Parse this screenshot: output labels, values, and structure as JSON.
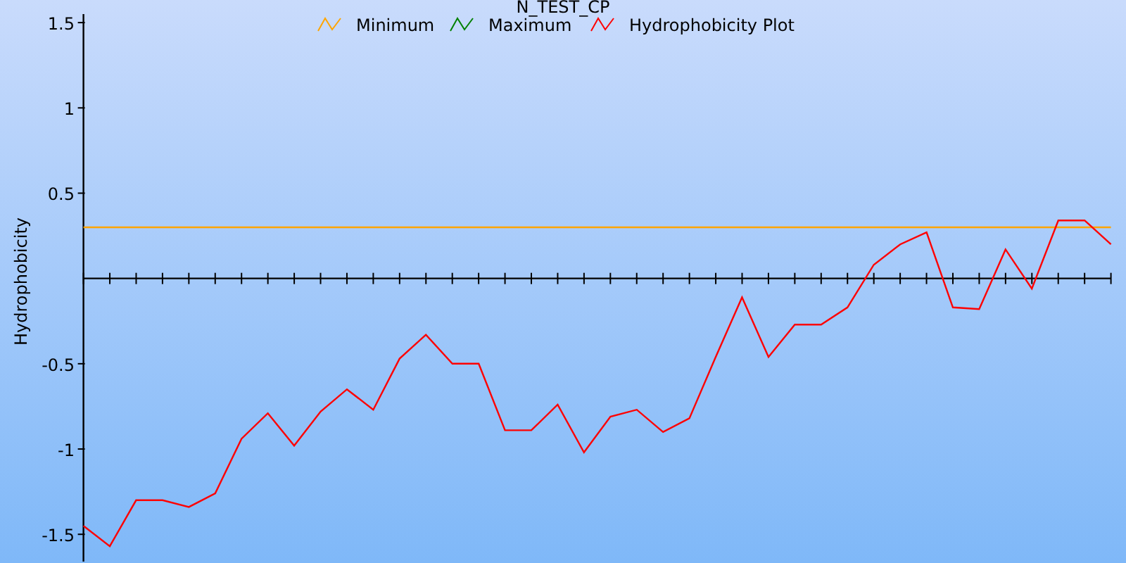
{
  "chart_data": {
    "type": "line",
    "title": "N_TEST_CP",
    "ylabel": "Hydrophobicity",
    "legend": "top",
    "ylim": [
      -1.66,
      1.55
    ],
    "yticks": [
      -1.5,
      -1,
      -0.5,
      0.5,
      1,
      1.5
    ],
    "series": [
      {
        "name": "Minimum",
        "color": "#ffa500",
        "values": [
          0.3,
          0.3,
          0.3,
          0.3,
          0.3,
          0.3,
          0.3,
          0.3,
          0.3,
          0.3,
          0.3,
          0.3,
          0.3,
          0.3,
          0.3,
          0.3,
          0.3,
          0.3,
          0.3,
          0.3,
          0.3,
          0.3,
          0.3,
          0.3,
          0.3,
          0.3,
          0.3,
          0.3,
          0.3,
          0.3,
          0.3,
          0.3,
          0.3,
          0.3,
          0.3,
          0.3,
          0.3,
          0.3,
          0.3,
          0.3
        ]
      },
      {
        "name": "Maximum",
        "color": "#008000",
        "values": [
          null,
          null,
          null,
          null,
          null,
          null,
          null,
          null,
          null,
          null,
          null,
          null,
          null,
          null,
          null,
          null,
          null,
          null,
          null,
          null,
          null,
          null,
          null,
          null,
          null,
          null,
          null,
          null,
          null,
          null,
          null,
          null,
          null,
          null,
          null,
          null,
          null,
          null,
          null,
          null
        ]
      },
      {
        "name": "Hydrophobicity Plot",
        "color": "#ff0000",
        "values": [
          -1.45,
          -1.57,
          -1.3,
          -1.3,
          -1.34,
          -1.26,
          -0.94,
          -0.79,
          -0.98,
          -0.78,
          -0.65,
          -0.77,
          -0.47,
          -0.33,
          -0.5,
          -0.5,
          -0.89,
          -0.89,
          -0.74,
          -1.02,
          -0.81,
          -0.77,
          -0.9,
          -0.82,
          -0.46,
          -0.11,
          -0.46,
          -0.27,
          -0.27,
          -0.17,
          0.08,
          0.2,
          0.27,
          -0.17,
          -0.18,
          0.17,
          -0.06,
          0.34,
          0.34,
          0.2
        ]
      }
    ]
  }
}
